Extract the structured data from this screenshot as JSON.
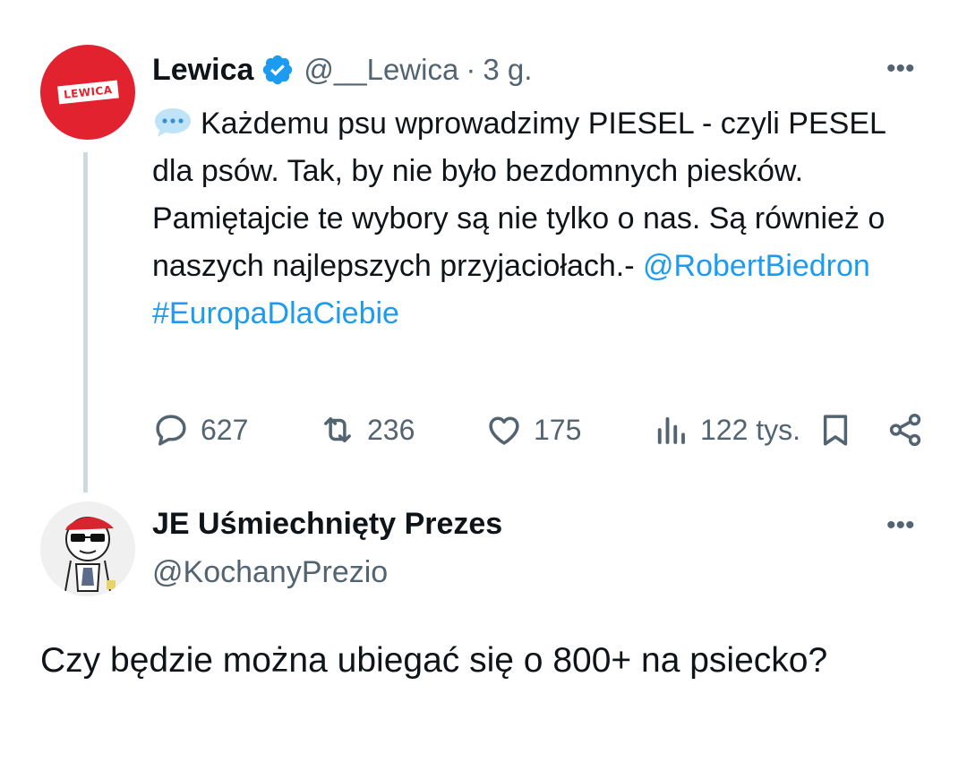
{
  "tweet": {
    "author_name": "Lewica",
    "avatar_logo_text": "LEWICA",
    "handle": "@__Lewica",
    "separator": "·",
    "time": "3 g.",
    "more_label": "•••",
    "text_intro": "Każdemu psu wprowadzimy PIESEL - czyli PESEL dla psów. Tak, by nie było bezdomnych piesków. Pamiętajcie te wybory są nie tylko o nas. Są również o naszych najlepszych przyjaciołach.- ",
    "mention": "@RobertBiedron",
    "hashtag": "#EuropaDlaCiebie",
    "stats": {
      "replies": "627",
      "reposts": "236",
      "likes": "175",
      "views": "122 tys."
    },
    "icons": [
      "speech-bubble-icon",
      "verified-badge-icon",
      "reply-icon",
      "repost-icon",
      "like-icon",
      "views-icon",
      "bookmark-icon",
      "share-icon"
    ],
    "colors": {
      "link": "#1d9bf0",
      "verified": "#1d9bf0",
      "avatar_bg": "#e3222f",
      "muted": "#536471",
      "thread_line": "#cfd9de"
    }
  },
  "reply": {
    "author_name": "JE Uśmiechnięty Prezes",
    "handle": "@KochanyPrezio",
    "more_label": "•••",
    "text": "Czy będzie można ubiegać się o 800+ na psiecko?"
  }
}
